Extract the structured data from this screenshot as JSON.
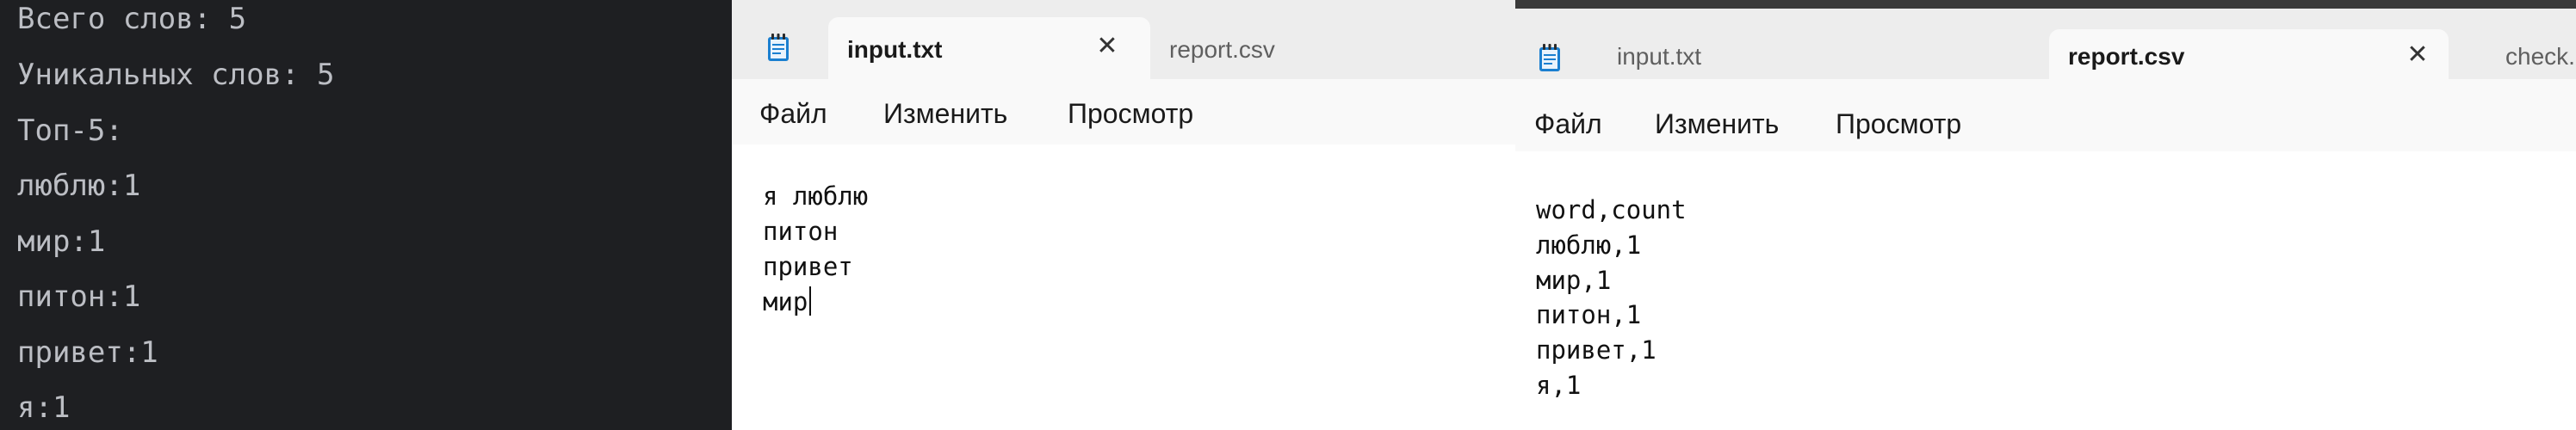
{
  "terminal": {
    "lines": [
      "Всего слов: 5",
      "Уникальных слов: 5",
      "Топ-5:",
      "люблю:1",
      "мир:1",
      "питон:1",
      "привет:1",
      "я:1"
    ]
  },
  "notepad_input": {
    "tabs": [
      {
        "label": "input.txt",
        "active": true
      },
      {
        "label": "report.csv",
        "active": false
      }
    ],
    "menu": [
      "Файл",
      "Изменить",
      "Просмотр"
    ],
    "content_lines": [
      "я люблю",
      "питон",
      "привет",
      "мир"
    ]
  },
  "notepad_report": {
    "tabs": [
      {
        "label": "input.txt",
        "active": false
      },
      {
        "label": "report.csv",
        "active": true
      },
      {
        "label": "check.c",
        "active": false
      }
    ],
    "menu": [
      "Файл",
      "Изменить",
      "Просмотр"
    ],
    "content_lines": [
      "word,count",
      "люблю,1",
      "мир,1",
      "питон,1",
      "привет,1",
      "я,1"
    ]
  },
  "icons": {
    "app": "notepad-icon",
    "close": "close-icon"
  },
  "colors": {
    "terminal_bg": "#1e1f22",
    "terminal_text": "#bcbec4",
    "notepad_icon": "#1a7fd0"
  }
}
